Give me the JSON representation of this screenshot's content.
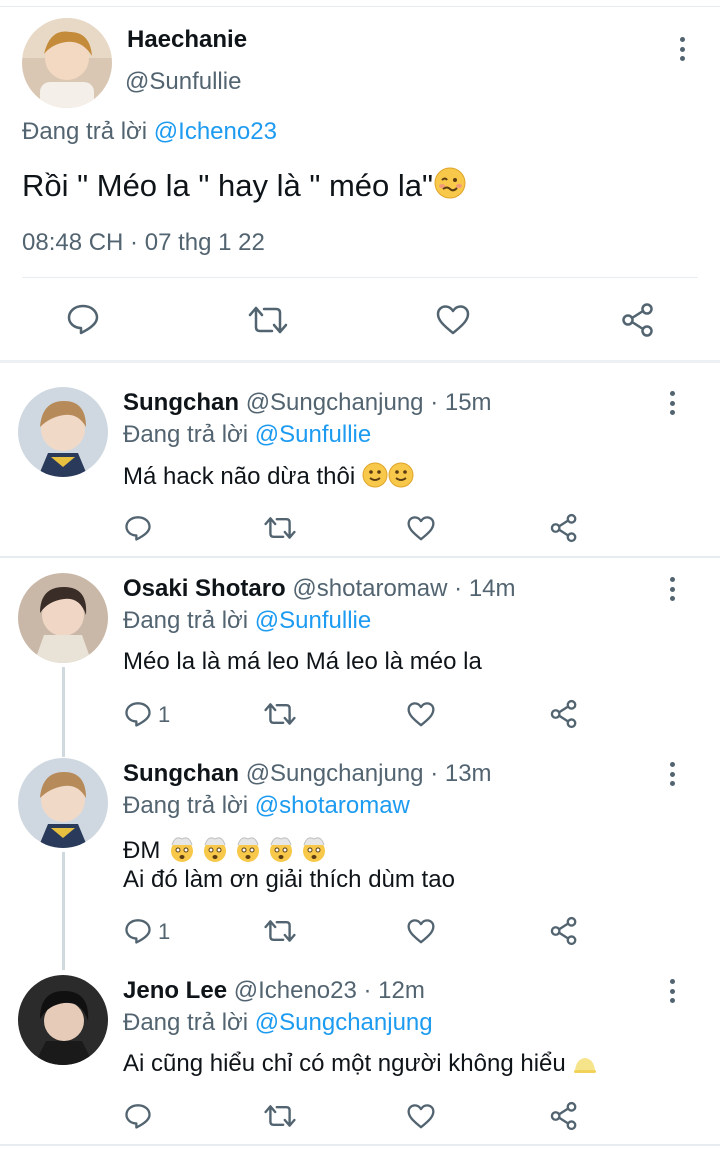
{
  "main_tweet": {
    "display_name": "Haechanie",
    "handle": "@Sunfullie",
    "replying_prefix": "Đang trả lời ",
    "replying_to": "@Icheno23",
    "text": "Rồi \" Méo la \" hay là \" méo la\"",
    "timestamp": "08:48 CH · 07 thg 1 22",
    "emoji": "woozy-face"
  },
  "replies": [
    {
      "display_name": "Sungchan",
      "handle": "@Sungchanjung",
      "time": " · 15m",
      "replying_prefix": "Đang trả lời ",
      "replying_to": "@Sunfullie",
      "text": "Má hack não dừa thôi",
      "reply_count": ""
    },
    {
      "display_name": "Osaki Shotaro",
      "handle": "@shotaromaw",
      "time": " · 14m",
      "replying_prefix": "Đang trả lời ",
      "replying_to": "@Sunfullie",
      "text": "Méo la là má leo Má leo là méo la",
      "reply_count": "1"
    },
    {
      "display_name": "Sungchan",
      "handle": "@Sungchanjung",
      "time": " · 13m",
      "replying_prefix": "Đang trả lời ",
      "replying_to": "@shotaromaw",
      "text_line1": "ĐM",
      "text_line2": "Ai đó làm ơn giải thích dùm tao",
      "reply_count": "1"
    },
    {
      "display_name": "Jeno Lee",
      "handle": "@Icheno23",
      "time": " · 12m",
      "replying_prefix": "Đang trả lời ",
      "replying_to": "@Sungchanjung",
      "text": "Ai cũng hiểu chỉ có một người không hiểu",
      "reply_count": ""
    }
  ],
  "colors": {
    "link": "#1d9bf0",
    "muted": "#536471",
    "text": "#0f1419",
    "divider": "#e6ecf0"
  }
}
